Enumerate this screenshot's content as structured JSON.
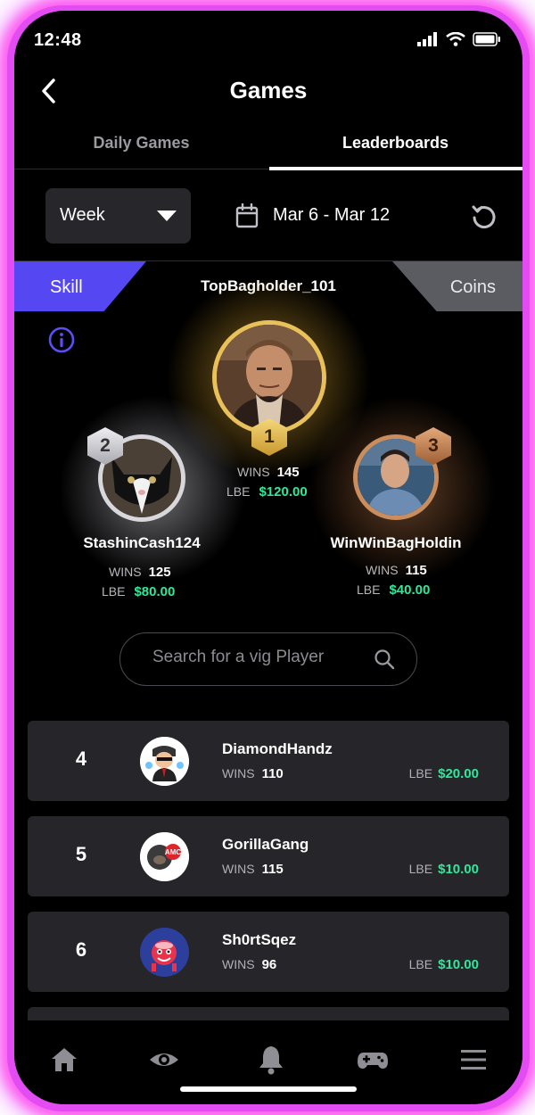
{
  "status_bar": {
    "time": "12:48"
  },
  "header": {
    "title": "Games"
  },
  "tabs": [
    {
      "label": "Daily Games",
      "active": false
    },
    {
      "label": "Leaderboards",
      "active": true
    }
  ],
  "filters": {
    "period": "Week",
    "date_range": "Mar 6 - Mar 12"
  },
  "mode_tabs": {
    "skill": "Skill",
    "coins": "Coins"
  },
  "podium": {
    "first": {
      "name": "TopBagholder_101",
      "rank": "1",
      "wins_label": "WINS",
      "wins": "145",
      "lbe_label": "LBE",
      "lbe": "$120.00"
    },
    "second": {
      "name": "StashinCash124",
      "rank": "2",
      "wins_label": "WINS",
      "wins": "125",
      "lbe_label": "LBE",
      "lbe": "$80.00"
    },
    "third": {
      "name": "WinWinBagHoldin",
      "rank": "3",
      "wins_label": "WINS",
      "wins": "115",
      "lbe_label": "LBE",
      "lbe": "$40.00"
    }
  },
  "search": {
    "placeholder": "Search for a vig Player"
  },
  "leaderboard": [
    {
      "rank": "4",
      "name": "DiamondHandz",
      "wins_label": "WINS",
      "wins": "110",
      "lbe_label": "LBE",
      "lbe": "$20.00"
    },
    {
      "rank": "5",
      "name": "GorillaGang",
      "wins_label": "WINS",
      "wins": "115",
      "lbe_label": "LBE",
      "lbe": "$10.00"
    },
    {
      "rank": "6",
      "name": "Sh0rtSqez",
      "wins_label": "WINS",
      "wins": "96",
      "lbe_label": "LBE",
      "lbe": "$10.00"
    }
  ],
  "avatar_badge_text": "AMC",
  "bottom_nav": [
    "home-icon",
    "eye-icon",
    "bell-icon",
    "gamepad-icon",
    "menu-icon"
  ],
  "colors": {
    "accent": "#5548f2",
    "money": "#2fe89a",
    "gold": "#e8c15a",
    "silver": "#d8d8dc",
    "bronze": "#c98d5e",
    "glow": "#ff5cf0"
  }
}
